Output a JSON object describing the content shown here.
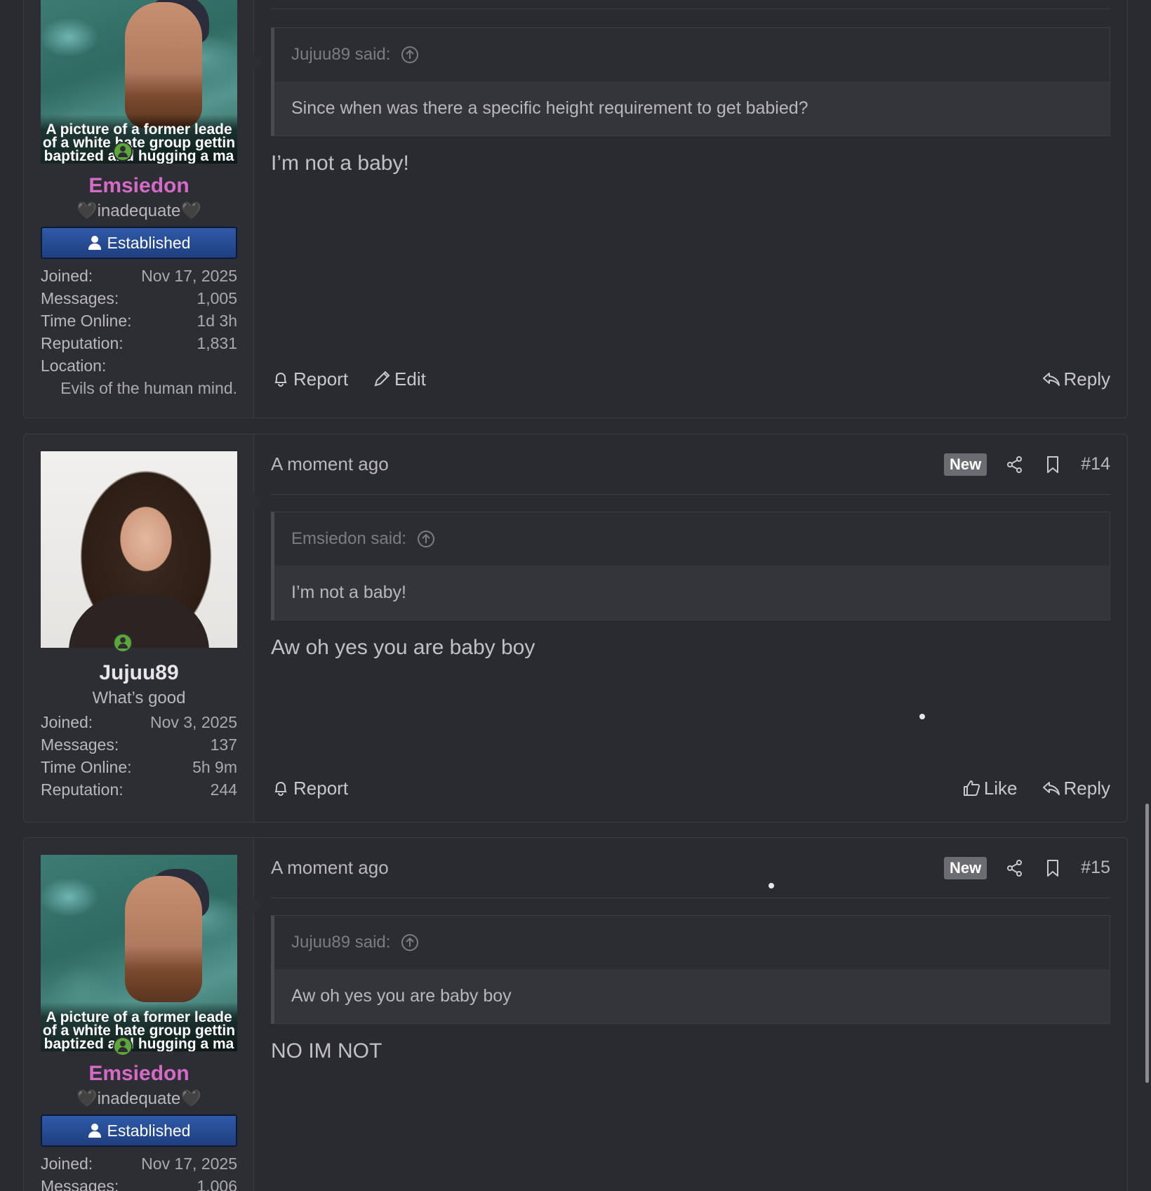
{
  "posts": [
    {
      "username": "Emsiedon",
      "user_title": "🖤inadequate🖤",
      "banner": "Established",
      "avatar_caption_lines": [
        "A picture of a former leade",
        "of a white hate group gettin",
        "baptized and hugging a ma"
      ],
      "stats": [
        {
          "label": "Joined:",
          "value": "Nov 17, 2025"
        },
        {
          "label": "Messages:",
          "value": "1,005"
        },
        {
          "label": "Time Online:",
          "value": "1d 3h"
        },
        {
          "label": "Reputation:",
          "value": "1,831"
        },
        {
          "label": "Location:",
          "value": ""
        }
      ],
      "location": "Evils of the human mind.",
      "quote_author": "Jujuu89 said:",
      "quote_text": "Since when was there a specific height requirement to get babied?",
      "message": "I’m not a baby!",
      "actions_left": [
        "Report",
        "Edit"
      ],
      "actions_right": [
        "Reply"
      ]
    },
    {
      "time": "A moment ago",
      "badge": "New",
      "post_number": "#14",
      "username": "Jujuu89",
      "user_title": "What’s good",
      "stats": [
        {
          "label": "Joined:",
          "value": "Nov 3, 2025"
        },
        {
          "label": "Messages:",
          "value": "137"
        },
        {
          "label": "Time Online:",
          "value": "5h 9m"
        },
        {
          "label": "Reputation:",
          "value": "244"
        }
      ],
      "quote_author": "Emsiedon said:",
      "quote_text": "I’m not a baby!",
      "message": "Aw oh yes you are baby boy",
      "actions_left": [
        "Report"
      ],
      "actions_right": [
        "Like",
        "Reply"
      ]
    },
    {
      "time": "A moment ago",
      "badge": "New",
      "post_number": "#15",
      "username": "Emsiedon",
      "user_title": "🖤inadequate🖤",
      "banner": "Established",
      "avatar_caption_lines": [
        "A picture of a former leade",
        "of a white hate group gettin",
        "baptized and hugging a ma"
      ],
      "stats": [
        {
          "label": "Joined:",
          "value": "Nov 17, 2025"
        },
        {
          "label": "Messages:",
          "value": "1,006"
        }
      ],
      "quote_author": "Jujuu89 said:",
      "quote_text": "Aw oh yes you are baby boy",
      "message": "NO IM NOT"
    }
  ],
  "icons": {
    "report": "bell-icon",
    "edit": "pencil-icon",
    "reply": "reply-arrow-icon",
    "like": "thumbs-up-icon",
    "share": "share-icon",
    "bookmark": "bookmark-icon",
    "quote_jump": "arrow-up-circle-icon",
    "online": "online-status-icon"
  },
  "colors": {
    "background": "#2a2b30",
    "username_pink": "#d46bc7",
    "banner_blue": "#2f5aa8",
    "online_green": "#5ba73a"
  }
}
